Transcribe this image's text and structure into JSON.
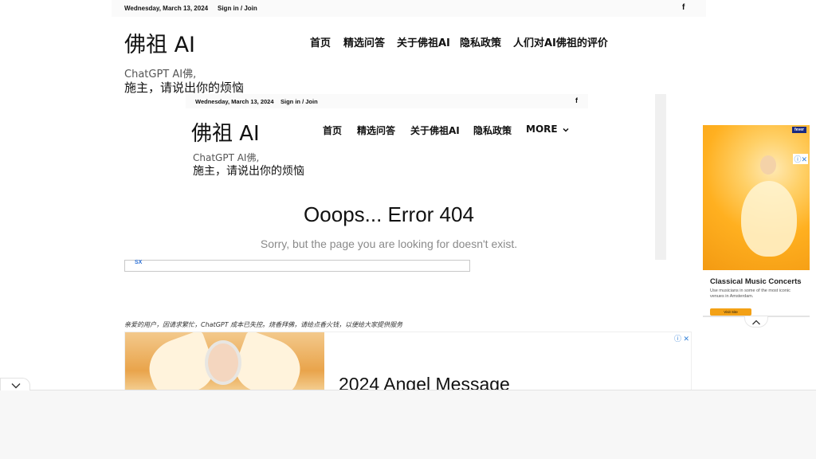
{
  "header": {
    "date": "Wednesday, March 13, 2024",
    "signin": "Sign in / Join",
    "facebook_icon": "f",
    "logo": "佛祖 AI",
    "nav": [
      "首页",
      "精选问答",
      "关于佛祖AI",
      "隐私政策",
      "人们对AI佛祖的评价"
    ],
    "tagline_line1": "ChatGPT AI佛,",
    "tagline_line2": "施主，请说出你的烦恼"
  },
  "embedded_page": {
    "date": "Wednesday, March 13, 2024",
    "signin": "Sign in / Join",
    "facebook_icon": "f",
    "logo": "佛祖 AI",
    "nav": [
      "首页",
      "精选问答",
      "关于佛祖AI",
      "隐私政策"
    ],
    "more_label": "MORE",
    "tagline_line1": "ChatGPT AI佛,",
    "tagline_line2": "施主，请说出你的烦恼",
    "error_title": "Ooops... Error 404",
    "error_subtitle": "Sorry, but the page you are looking for doesn't exist."
  },
  "broken_image": {
    "alt": "SX"
  },
  "notice": "亲爱的用户，因请求繁忙，ChatGPT 成本已失控。烧香拜佛，请给点香火钱，以便给大家提供服务",
  "ad_bottom": {
    "title": "2024 Angel Message",
    "badge": "ⓘ ✕"
  },
  "ad_right": {
    "brand": "fever",
    "badge": "ⓘ✕",
    "title": "Classical Music Concerts",
    "text": "Use musicians in some of the most iconic venues in Amsterdam.",
    "button": "Visit Site"
  },
  "icons": {
    "collapse_up": "chevron-up-icon",
    "collapse_down": "chevron-down-icon",
    "more_chevron": "chevron-down-icon"
  }
}
